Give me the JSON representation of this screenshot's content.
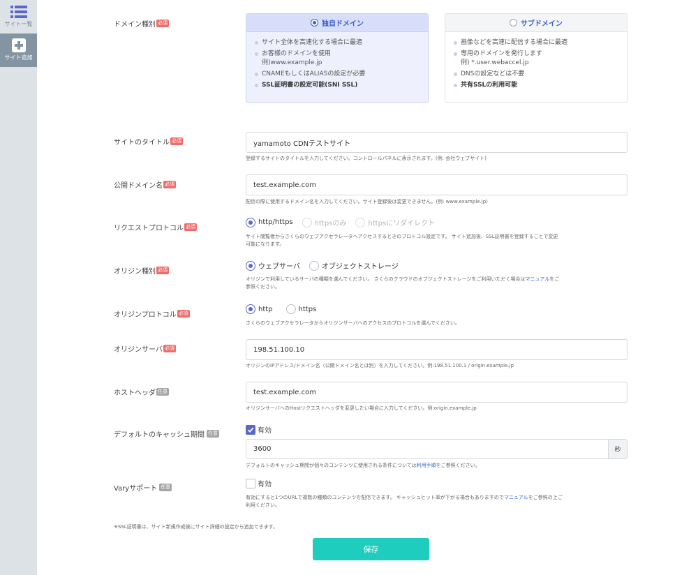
{
  "sidebar": {
    "items": [
      {
        "label": "サイト一覧",
        "icon": "list-icon"
      },
      {
        "label": "サイト追加",
        "icon": "plus-square-icon"
      }
    ]
  },
  "badges": {
    "required": "必須",
    "optional": "任意"
  },
  "domain_type": {
    "label": "ドメイン種別",
    "options": [
      {
        "title": "独自ドメイン",
        "selected": true,
        "points": [
          "サイト全体を高速化する場合に最適",
          "お客様のドメインを使用",
          "例)www.example.jp",
          "CNAMEもしくはALIASの設定が必要",
          "SSL証明書の設定可能(SNI SSL)"
        ]
      },
      {
        "title": "サブドメイン",
        "selected": false,
        "points": [
          "画像などを高速に配信する場合に最適",
          "専用のドメインを発行します",
          "例) *.user.webaccel.jp",
          "DNSの設定などは不要",
          "共有SSLの利用可能"
        ]
      }
    ]
  },
  "site_title": {
    "label": "サイトのタイトル",
    "value": "yamamoto CDNテストサイト",
    "help": "登録するサイトのタイトルを入力してください。コントロールパネルに表示されます。(例: 会社ウェブサイト)"
  },
  "public_domain": {
    "label": "公開ドメイン名",
    "value": "test.example.com",
    "help": "配信の際に使用するドメイン名を入力してください。サイト登録後は変更できません。(例: www.example.jp)"
  },
  "request_protocol": {
    "label": "リクエストプロトコル",
    "options": [
      "http/https",
      "httpsのみ",
      "httpsにリダイレクト"
    ],
    "selected": "http/https",
    "help_1": "サイト閲覧者からさくらのウェブアクセラレータへアクセスするときのプロトコル設定です。 サイト追加後、SSL証明書を登録することで変更",
    "help_2": "可能になります。"
  },
  "origin_type": {
    "label": "オリジン種別",
    "options": [
      "ウェブサーバ",
      "オブジェクトストレージ"
    ],
    "selected": "ウェブサーバ",
    "help_1a": "オリジンで利用しているサーバの種類を選んでください。 さくらのクラウドのオブジェクトストレージをご利用いただく場合は",
    "help_link": "マニュアル",
    "help_1b": "をご",
    "help_2": "参照ください。"
  },
  "origin_protocol": {
    "label": "オリジンプロトコル",
    "options": [
      "http",
      "https"
    ],
    "selected": "http",
    "help": "さくらのウェブアクセラレータからオリジンサーバへのアクセスのプロトコルを選んでください。"
  },
  "origin_server": {
    "label": "オリジンサーバ",
    "value": "198.51.100.10",
    "help": "オリジンのIPアドレス/ドメイン名（公開ドメイン名とは別）を入力してください。例:198.51.100.1 / origin.example.jp"
  },
  "host_header": {
    "label": "ホストヘッダ",
    "value": "test.example.com",
    "help": "オリジンサーバへのHostリクエストヘッダを変更したい場合に入力してください。例:origin.example.jp"
  },
  "default_cache": {
    "label": "デフォルトのキャッシュ期間",
    "check_label": "有効",
    "checked": true,
    "value": "3600",
    "unit": "秒",
    "help_a": "デフォルトのキャッシュ期間が個々のコンテンツに使用される条件については",
    "help_link": "利用手順",
    "help_b": "をご参照ください。"
  },
  "vary": {
    "label": "Varyサポート",
    "check_label": "有効",
    "checked": false,
    "help_1a": "有効にすると1つのURLで複数の種類のコンテンツを配信できます。 キャッシュヒット率が下がる場合もありますので",
    "help_link": "マニュアル",
    "help_1b": "をご参照の上ご",
    "help_2": "利用ください。"
  },
  "footer_note": "※SSL証明書は、サイト新規作成後にサイト詳細の設定から追加できます。",
  "save_label": "保存",
  "colors": {
    "accent": "#5a69c7",
    "save": "#1fcdbf",
    "required": "#f06b6b",
    "link": "#2f66c9"
  }
}
